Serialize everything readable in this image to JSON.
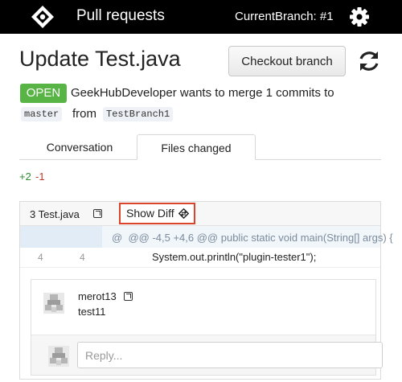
{
  "header": {
    "title": "Pull requests",
    "branch_label": "CurrentBranch: #1",
    "logo_icon": "diamond-logo-icon",
    "settings_icon": "gear-icon"
  },
  "pr": {
    "title": "Update Test.java",
    "checkout_label": "Checkout branch",
    "refresh_icon": "refresh-icon",
    "status_badge": "OPEN",
    "status_color": "#58b444",
    "merge_summary": "GeekHubDeveloper wants to merge 1 commits to",
    "base_branch": "master",
    "from_label": "from",
    "head_branch": "TestBranch1"
  },
  "tabs": [
    {
      "label": "Conversation",
      "active": false
    },
    {
      "label": "Files changed",
      "active": true
    }
  ],
  "stats": {
    "additions": "+2",
    "deletions": "-1"
  },
  "diff": {
    "file_label": "3  Test.java",
    "show_diff_label": "Show Diff",
    "hunk_header": "@@ -4,5 +4,6 @@ public static void main(String[] args) {",
    "hunk_prefix": "@",
    "line": {
      "old": "4",
      "new": "4",
      "code": "System.out.println(\"plugin-tester1\");"
    }
  },
  "comment": {
    "author": "merot13",
    "body": "test11",
    "reply_placeholder": "Reply..."
  }
}
